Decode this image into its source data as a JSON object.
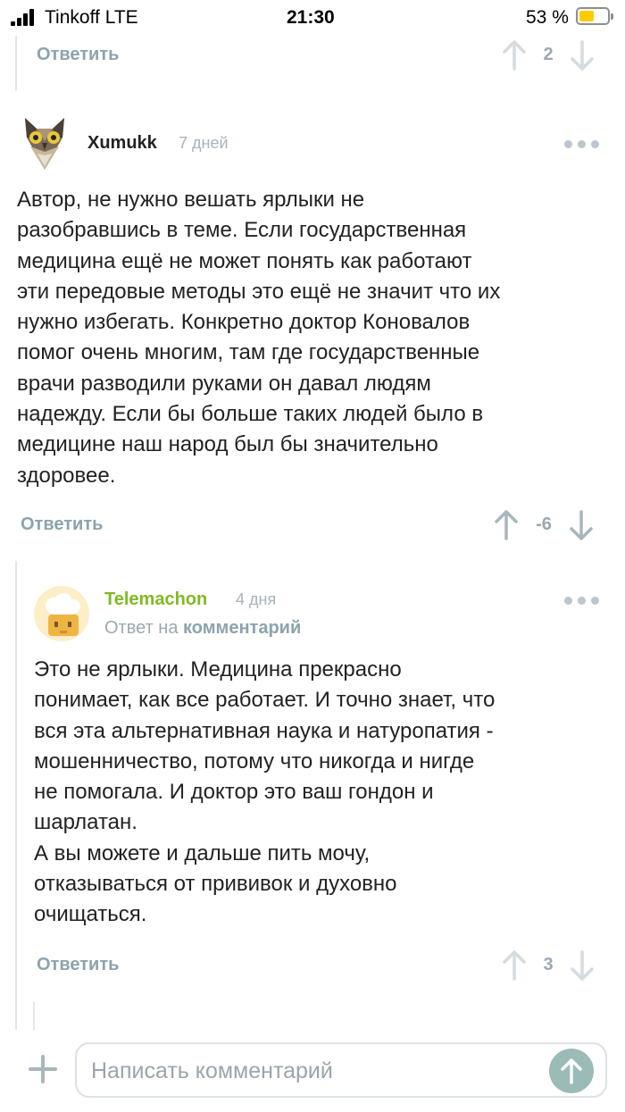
{
  "status_bar": {
    "carrier": "Tinkoff LTE",
    "time": "21:30",
    "battery_percent": "53 %",
    "battery_level": 0.53
  },
  "top_comment": {
    "reply_label": "Ответить",
    "score": "2"
  },
  "comment_1": {
    "author": "Xumukk",
    "date": "7 дней",
    "avatar_icon": "owl-avatar-icon",
    "text": "Автор, не нужно вешать ярлыки не\nразобравшись в теме. Если государственная\nмедицина ещё не может понять как работают\nэти передовые методы это ещё не значит что их\nнужно избегать. Конкретно доктор Коновалов\nпомог очень многим, там где государственные\nврачи разводили руками он давал людям\nнадежду. Если бы больше таких людей было в\nмедицине наш народ был бы значительно\nздоровее.",
    "reply_label": "Ответить",
    "score": "-6"
  },
  "comment_2": {
    "author": "Telemachon",
    "date": "4 дня",
    "avatar_icon": "chef-avatar-icon",
    "reply_prefix": "Ответ на",
    "reply_link": "комментарий",
    "text": "Это не ярлыки. Медицина прекрасно\nпонимает, как все работает. И точно знает, что\nвся эта альтернативная наука и натуропатия -\nмошенничество, потому что никогда и нигде\nне помогала. И доктор это ваш гондон и\nшарлатан.\nА вы можете и дальше пить мочу,\nотказываться от прививок и духовно\nочищаться.",
    "reply_label": "Ответить",
    "score": "3"
  },
  "composer": {
    "placeholder": "Написать комментарий"
  },
  "colors": {
    "author_1": "#222222",
    "author_2": "#7fba23",
    "accent": "#8ba4ae",
    "send_button": "#9bbbb7"
  }
}
